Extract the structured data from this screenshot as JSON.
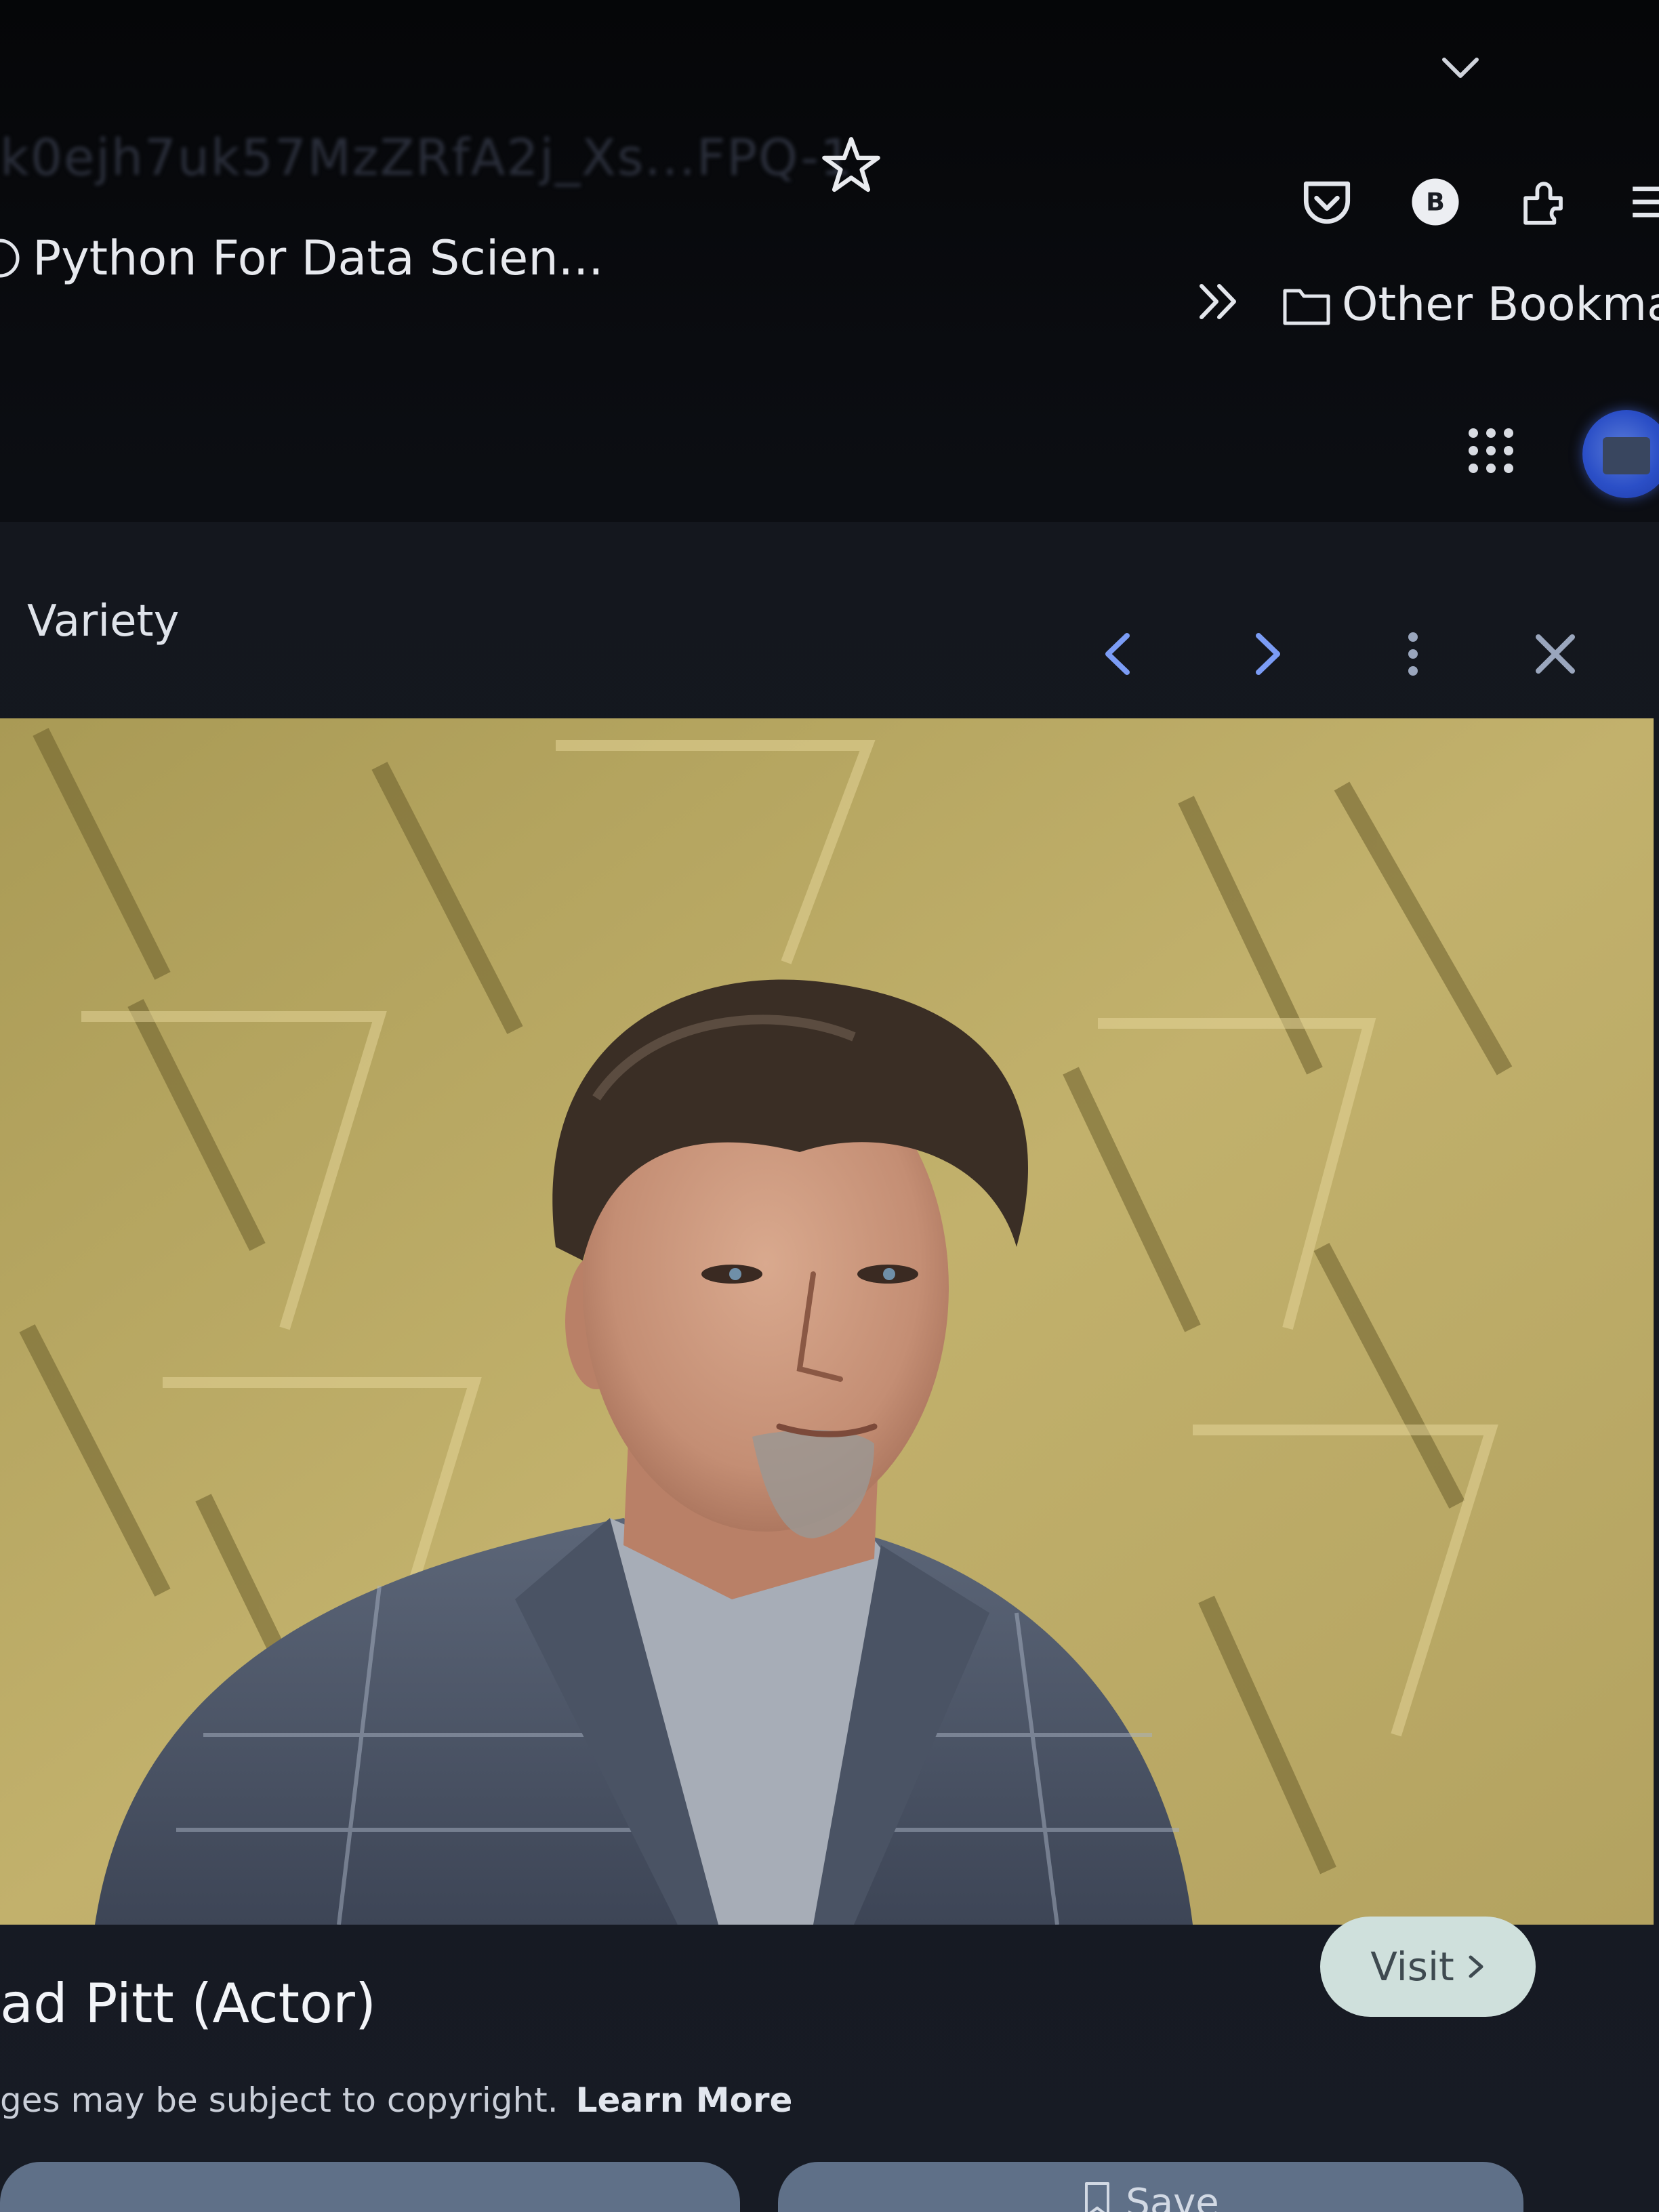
{
  "browser": {
    "url_fragment": "k0ejh7uk57MzZRfA2j_Xs...FPQ-1",
    "bookmarks": [
      {
        "label": "Python For Data Scien..."
      }
    ],
    "other_bookmarks_label": "Other Bookmark"
  },
  "viewer": {
    "source": "Variety",
    "title": "ad Pitt (Actor)",
    "visit_label": "Visit",
    "copyright_text": "ges may be subject to copyright.",
    "learn_more_label": "Learn More",
    "save_label": "Save"
  },
  "colors": {
    "chrome_bg": "#0c0e13",
    "avatar_blue": "#2b4fc7",
    "visit_bg": "#cfe0dc",
    "action_button_bg": "#5f7088"
  },
  "icons": [
    "chevron-down-icon",
    "star-icon",
    "pocket-icon",
    "profile-b-icon",
    "extensions-icon",
    "menu-icon",
    "globe-icon",
    "double-chevron-icon",
    "folder-icon",
    "apps-grid-icon",
    "chevron-left-icon",
    "chevron-right-icon",
    "more-vert-icon",
    "close-icon",
    "bookmark-icon"
  ]
}
